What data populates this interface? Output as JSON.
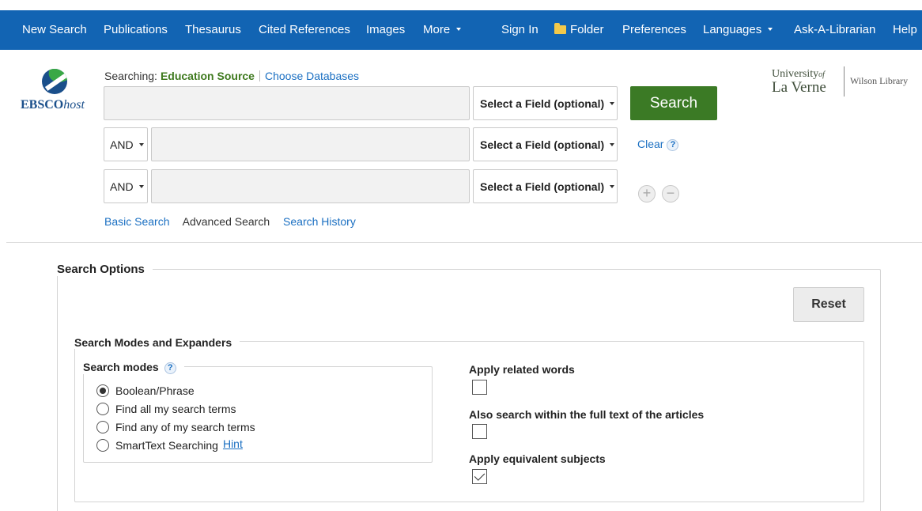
{
  "nav": {
    "items": [
      {
        "label": "New Search"
      },
      {
        "label": "Publications"
      },
      {
        "label": "Thesaurus"
      },
      {
        "label": "Cited References"
      },
      {
        "label": "Images"
      },
      {
        "label": "More"
      },
      {
        "label": "Sign In"
      },
      {
        "label": "Folder"
      },
      {
        "label": "Preferences"
      },
      {
        "label": "Languages"
      },
      {
        "label": "Ask-A-Librarian"
      },
      {
        "label": "Help"
      }
    ]
  },
  "logo": {
    "brand": "EBSCO",
    "brand_suffix": "host"
  },
  "searching": {
    "prefix": "Searching:",
    "database": "Education Source",
    "choose_link": "Choose Databases"
  },
  "search": {
    "rows": [
      {
        "operator": "",
        "value": "",
        "field": "Select a Field (optional)"
      },
      {
        "operator": "AND",
        "value": "",
        "field": "Select a Field (optional)"
      },
      {
        "operator": "AND",
        "value": "",
        "field": "Select a Field (optional)"
      }
    ],
    "search_button": "Search",
    "clear_link": "Clear",
    "help": "?",
    "add": "+",
    "remove": "−"
  },
  "search_links": {
    "basic": "Basic Search",
    "advanced": "Advanced Search",
    "history": "Search History"
  },
  "university": {
    "line1": "University",
    "of": "of",
    "line2": "La Verne",
    "library": "Wilson Library"
  },
  "options": {
    "title": "Search Options",
    "reset": "Reset",
    "modes_section": "Search Modes and Expanders",
    "modes_title": "Search modes",
    "modes_help": "?",
    "modes": [
      {
        "label": "Boolean/Phrase",
        "selected": true
      },
      {
        "label": "Find all my search terms",
        "selected": false
      },
      {
        "label": "Find any of my search terms",
        "selected": false
      },
      {
        "label": "SmartText Searching",
        "selected": false
      }
    ],
    "hint_link": "Hint",
    "expanders": [
      {
        "label": "Apply related words",
        "checked": false
      },
      {
        "label": "Also search within the full text of the articles",
        "checked": false
      },
      {
        "label": "Apply equivalent subjects",
        "checked": true
      }
    ]
  },
  "colors": {
    "nav_bg": "#1264b3",
    "search_button": "#3b7a25",
    "link": "#1a6fc2",
    "database": "#3f7a1f"
  }
}
